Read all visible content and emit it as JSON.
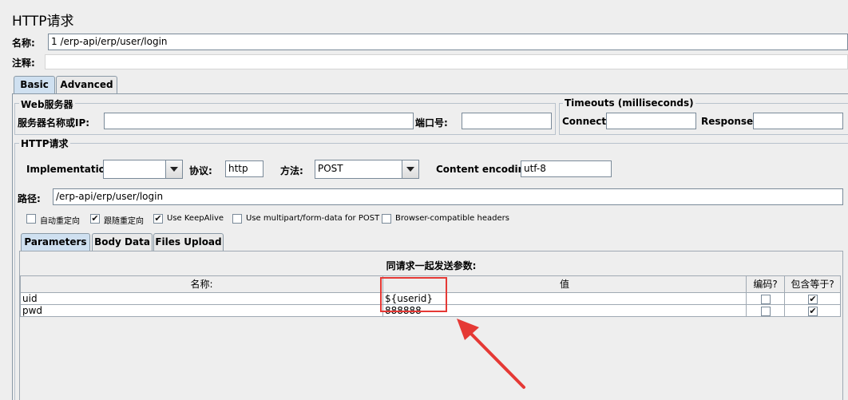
{
  "panel_title": "HTTP请求",
  "name_label": "名称:",
  "name_value": "1 /erp-api/erp/user/login",
  "comment_label": "注释:",
  "comment_value": "",
  "main_tabs": [
    "Basic",
    "Advanced"
  ],
  "web_server": {
    "legend": "Web服务器",
    "server_label": "服务器名称或IP:",
    "server_value": "",
    "port_label": "端口号:",
    "port_value": ""
  },
  "timeouts": {
    "legend": "Timeouts (milliseconds)",
    "connect_label": "Connect:",
    "connect_value": "",
    "response_label": "Response:",
    "response_value": ""
  },
  "http_request": {
    "legend": "HTTP请求",
    "implementation_label": "Implementation:",
    "implementation_value": "",
    "protocol_label": "协议:",
    "protocol_value": "http",
    "method_label": "方法:",
    "method_value": "POST",
    "encoding_label": "Content encoding:",
    "encoding_value": "utf-8",
    "path_label": "路径:",
    "path_value": "/erp-api/erp/user/login"
  },
  "options": [
    {
      "label": "自动重定向",
      "checked": false
    },
    {
      "label": "跟随重定向",
      "checked": true
    },
    {
      "label": "Use KeepAlive",
      "checked": true
    },
    {
      "label": "Use multipart/form-data for POST",
      "checked": false
    },
    {
      "label": "Browser-compatible headers",
      "checked": false
    }
  ],
  "param_tabs": [
    "Parameters",
    "Body Data",
    "Files Upload"
  ],
  "params_section_title": "同请求一起发送参数:",
  "params_columns": [
    "名称:",
    "值",
    "编码?",
    "包含等于?"
  ],
  "params_rows": [
    {
      "name": "uid",
      "value": "${userid}",
      "encode": false,
      "include_equals": true
    },
    {
      "name": "pwd",
      "value": "888888",
      "encode": false,
      "include_equals": true
    }
  ],
  "colors": {
    "highlight": "#e53935",
    "background": "#eeeeee",
    "active_tab": "#cfe0f0"
  }
}
